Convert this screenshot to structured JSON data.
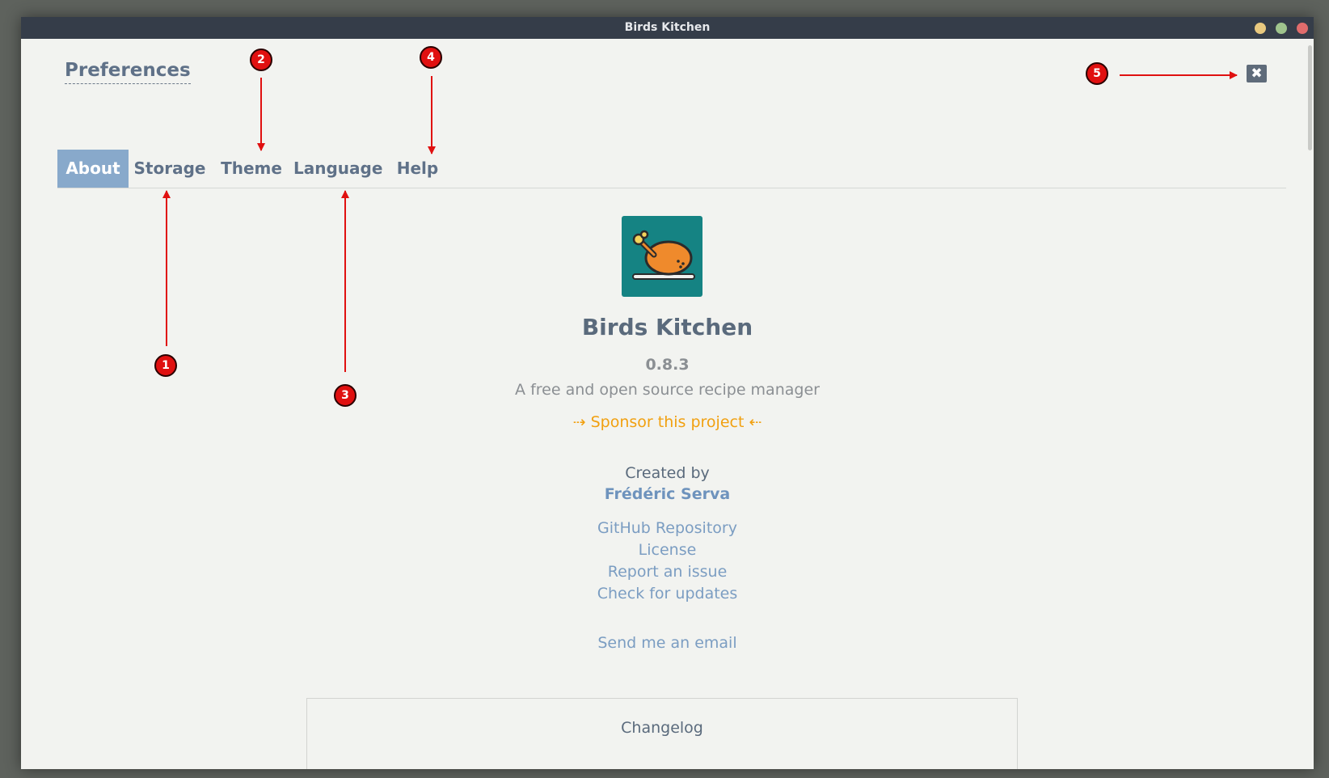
{
  "window": {
    "title": "Birds Kitchen"
  },
  "header": {
    "title": "Preferences",
    "close_icon": "close-icon"
  },
  "tabs": [
    {
      "label": "About",
      "active": true
    },
    {
      "label": "Storage",
      "active": false
    },
    {
      "label": "Theme",
      "active": false
    },
    {
      "label": "Language",
      "active": false
    },
    {
      "label": "Help",
      "active": false
    }
  ],
  "about": {
    "logo_icon": "roast-chicken-icon",
    "app_name": "Birds Kitchen",
    "version": "0.8.3",
    "tagline": "A free and open source recipe manager",
    "sponsor": "⇢ Sponsor this project ⇠",
    "created_by": "Created by",
    "author": "Frédéric Serva",
    "links": [
      "GitHub Repository",
      "License",
      "Report an issue",
      "Check for updates"
    ],
    "email_link": "Send me an email",
    "changelog_title": "Changelog"
  },
  "annotations": {
    "markers": [
      "1",
      "2",
      "3",
      "4",
      "5"
    ]
  },
  "colors": {
    "accent": "#88a9cb",
    "sponsor": "#f1a010",
    "annotation": "#e01010"
  }
}
